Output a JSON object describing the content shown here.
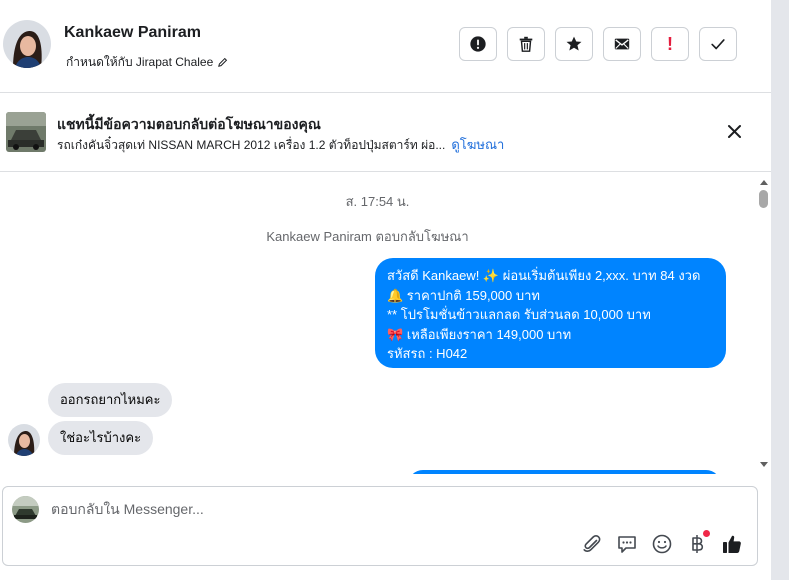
{
  "header": {
    "contact_name": "Kankaew Paniram",
    "assigned_to": "กำหนดให้กับ Jirapat Chalee",
    "actions": [
      {
        "name": "report-button",
        "icon": "alert-circle-icon"
      },
      {
        "name": "delete-button",
        "icon": "trash-icon"
      },
      {
        "name": "star-button",
        "icon": "star-icon"
      },
      {
        "name": "mark-unread-button",
        "icon": "envelope-icon"
      },
      {
        "name": "important-button",
        "icon": "exclamation-icon",
        "label": "!",
        "color": "#e41e3f"
      },
      {
        "name": "done-button",
        "icon": "check-icon"
      }
    ]
  },
  "ad_banner": {
    "title": "แชทนี้มีข้อความตอบกลับต่อโฆษณาของคุณ",
    "description": "รถเก๋งคันจิ๋วสุดเท่ NISSAN MARCH 2012 เครื่อง 1.2 ตัวท็อปปุ่มสตาร์ท ผ่อ...",
    "link_label": "ดูโฆษณา"
  },
  "chat": {
    "timestamp": "ส. 17:54 น.",
    "reply_note": "Kankaew Paniram ตอบกลับโฆษณา",
    "outgoing_message": {
      "lines": [
        "สวัสดี Kankaew! ✨  ผ่อนเริ่มต้นเพียง 2,xxx. บาท 84 งวด",
        "🔔 ราคาปกติ  159,000 บาท",
        "** โปรโมชั่นข้าวแลกลด รับส่วนลด 10,000 บาท",
        "🎀  เหลือเพียงราคา 149,000 บาท",
        " รหัสรถ : H042"
      ]
    },
    "incoming_messages": [
      "ออกรถยากไหมคะ",
      "ใช่อะไรบ้างคะ"
    ]
  },
  "composer": {
    "placeholder": "ตอบกลับใน Messenger...",
    "tools": [
      "paperclip-icon",
      "speech-bubble-icon",
      "smiley-icon",
      "baht-icon",
      "thumbs-up-icon"
    ]
  },
  "colors": {
    "brand_blue": "#0084ff",
    "link_blue": "#216fdb",
    "bubble_gray": "#e4e6eb",
    "alert_red": "#e41e3f"
  }
}
